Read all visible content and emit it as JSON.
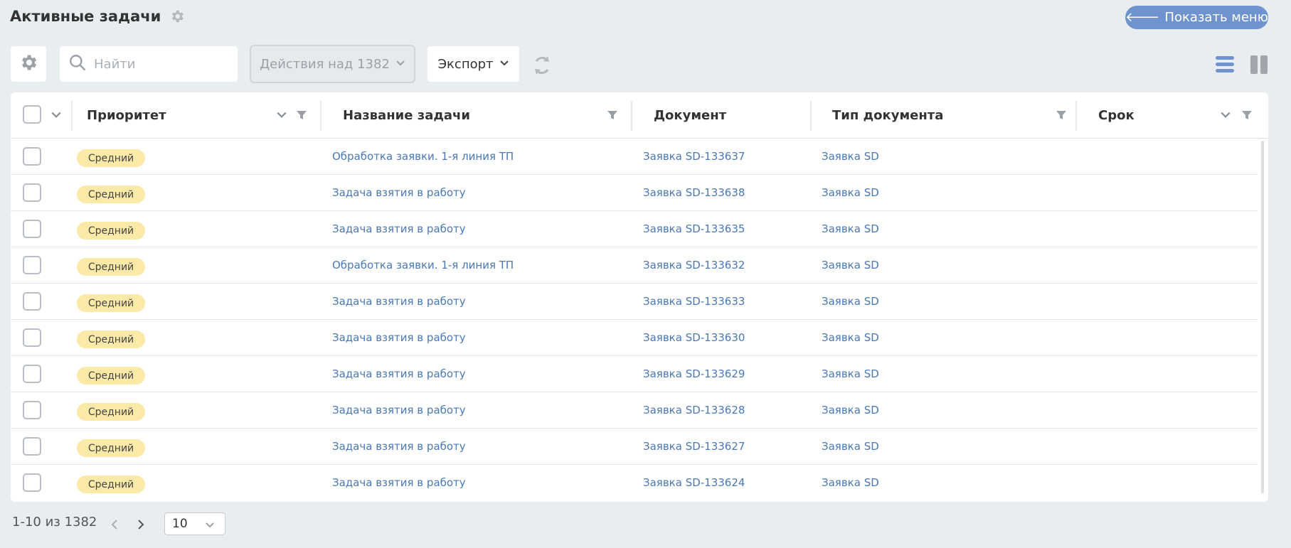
{
  "header": {
    "title": "Активные задачи",
    "menu_button": "Показать меню"
  },
  "toolbar": {
    "search_placeholder": "Найти",
    "actions_label": "Действия над 1382",
    "export_label": "Экспорт"
  },
  "table": {
    "columns": [
      "Приоритет",
      "Название задачи",
      "Документ",
      "Тип документа",
      "Срок"
    ],
    "rows": [
      {
        "priority": "Средний",
        "task": "Обработка заявки. 1-я линия ТП",
        "document": "Заявка SD-133637",
        "doc_type": "Заявка SD",
        "deadline": ""
      },
      {
        "priority": "Средний",
        "task": "Задача взятия в работу",
        "document": "Заявка SD-133638",
        "doc_type": "Заявка SD",
        "deadline": ""
      },
      {
        "priority": "Средний",
        "task": "Задача взятия в работу",
        "document": "Заявка SD-133635",
        "doc_type": "Заявка SD",
        "deadline": ""
      },
      {
        "priority": "Средний",
        "task": "Обработка заявки. 1-я линия ТП",
        "document": "Заявка SD-133632",
        "doc_type": "Заявка SD",
        "deadline": ""
      },
      {
        "priority": "Средний",
        "task": "Задача взятия в работу",
        "document": "Заявка SD-133633",
        "doc_type": "Заявка SD",
        "deadline": ""
      },
      {
        "priority": "Средний",
        "task": "Задача взятия в работу",
        "document": "Заявка SD-133630",
        "doc_type": "Заявка SD",
        "deadline": ""
      },
      {
        "priority": "Средний",
        "task": "Задача взятия в работу",
        "document": "Заявка SD-133629",
        "doc_type": "Заявка SD",
        "deadline": ""
      },
      {
        "priority": "Средний",
        "task": "Задача взятия в работу",
        "document": "Заявка SD-133628",
        "doc_type": "Заявка SD",
        "deadline": ""
      },
      {
        "priority": "Средний",
        "task": "Задача взятия в работу",
        "document": "Заявка SD-133627",
        "doc_type": "Заявка SD",
        "deadline": ""
      },
      {
        "priority": "Средний",
        "task": "Задача взятия в работу",
        "document": "Заявка SD-133624",
        "doc_type": "Заявка SD",
        "deadline": ""
      }
    ]
  },
  "pagination": {
    "range_text": "1-10 из 1382",
    "page_size": "10"
  },
  "colors": {
    "accent": "#6e93cf",
    "link": "#4a78b5",
    "badge_medium": "#fbe9a8",
    "background": "#e8edf0"
  },
  "icons": {
    "title_settings": "gear-icon",
    "settings": "gear-icon",
    "search": "search-icon",
    "refresh": "refresh-icon",
    "list_view": "list-view-icon",
    "columns_view": "columns-view-icon",
    "filter": "filter-icon",
    "sort": "chevron-down-icon"
  }
}
